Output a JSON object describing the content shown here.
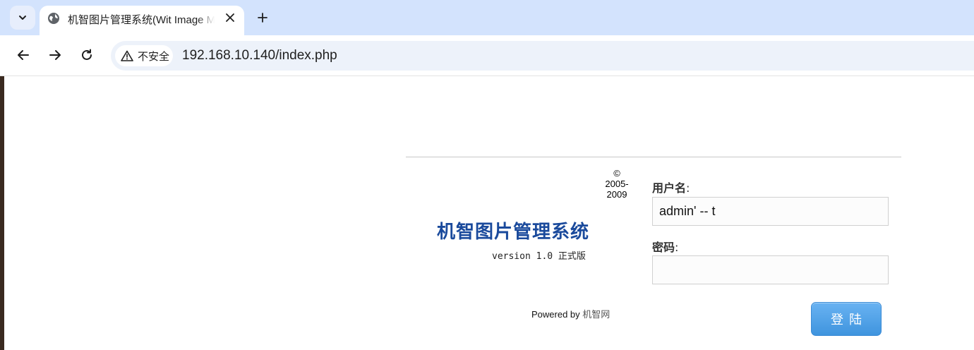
{
  "browser": {
    "tab": {
      "title": "机智图片管理系统(Wit Image Management System)"
    },
    "security_label": "不安全",
    "url": "192.168.10.140/index.php"
  },
  "page": {
    "copyright": "© 2005-2009",
    "brand_title": "机智图片管理系统",
    "version": "version 1.0 正式版",
    "powered_by_prefix": "Powered by ",
    "powered_by_link": "机智网",
    "username_label": "用户名",
    "username_value": "admin' -- t",
    "password_label": "密码",
    "password_value": "",
    "colon": ":",
    "login_button": "登陆"
  }
}
